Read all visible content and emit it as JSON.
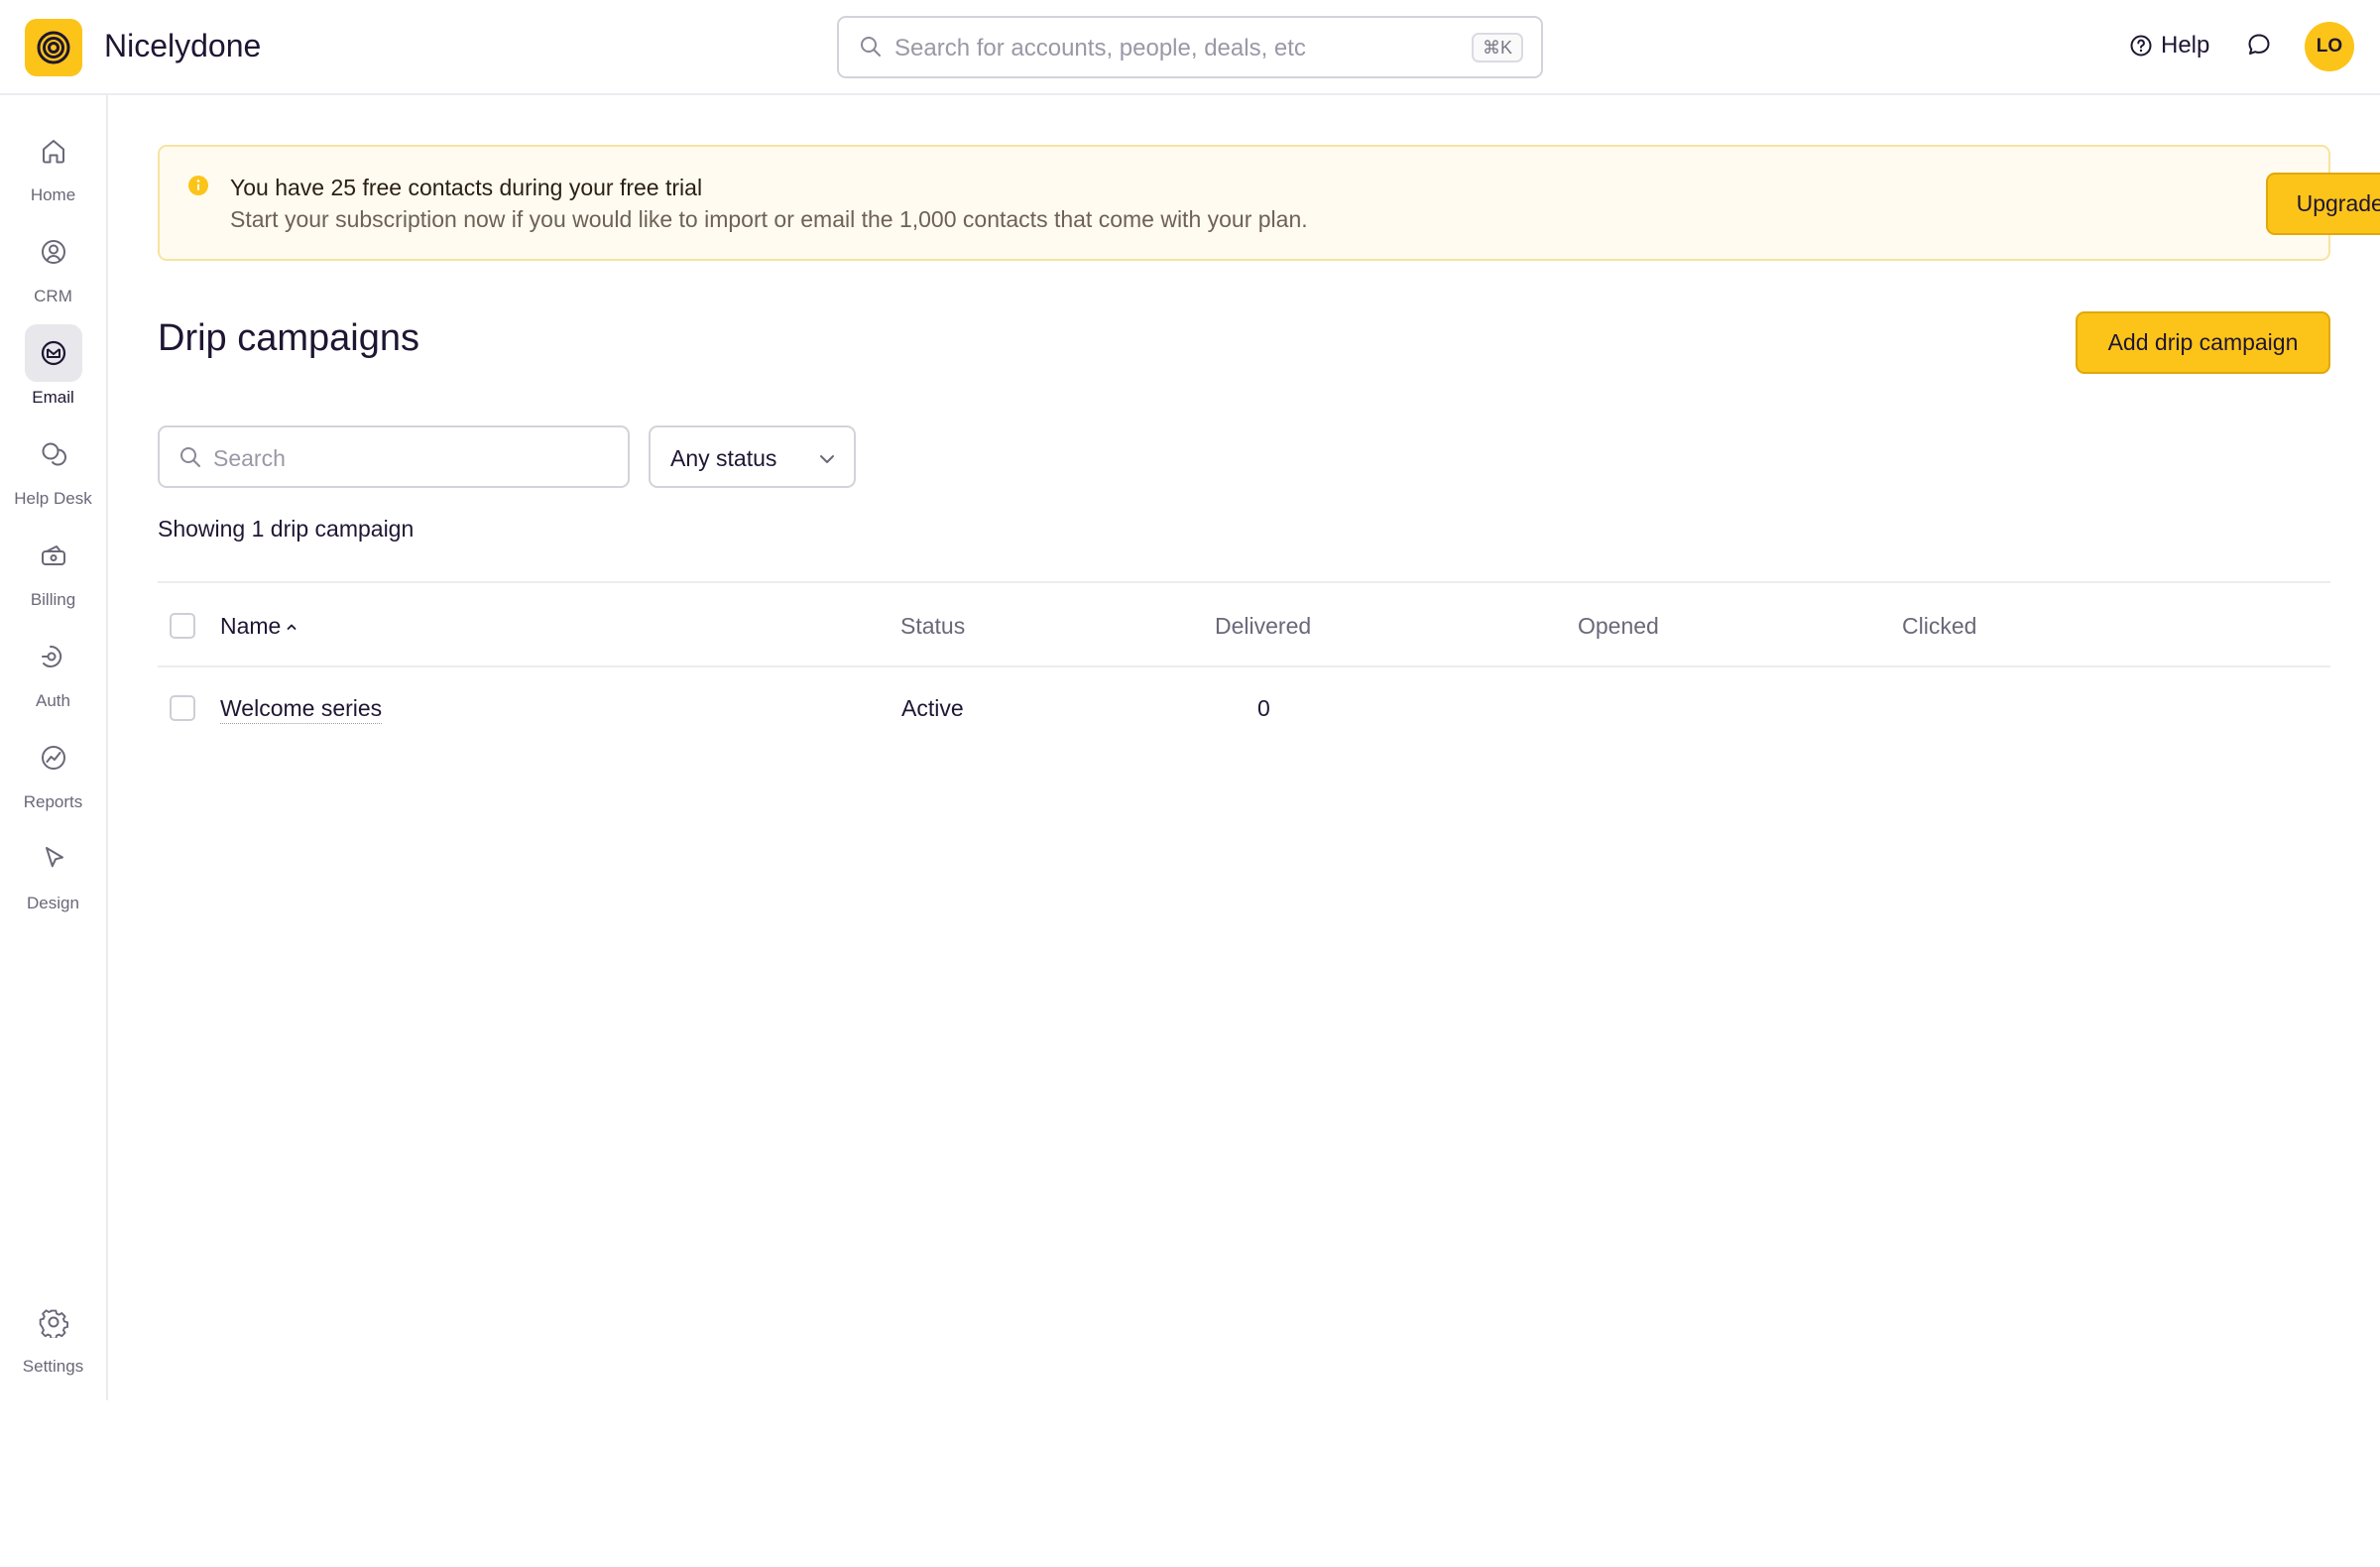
{
  "app": {
    "name": "Nicelydone"
  },
  "header": {
    "search_placeholder": "Search for accounts, people, deals, etc",
    "search_shortcut": "⌘K",
    "help_label": "Help",
    "avatar_initials": "LO"
  },
  "sidebar": {
    "items": [
      {
        "label": "Home",
        "icon": "home-icon",
        "active": false
      },
      {
        "label": "CRM",
        "icon": "crm-icon",
        "active": false
      },
      {
        "label": "Email",
        "icon": "email-icon",
        "active": true
      },
      {
        "label": "Help Desk",
        "icon": "helpdesk-icon",
        "active": false
      },
      {
        "label": "Billing",
        "icon": "billing-icon",
        "active": false
      },
      {
        "label": "Auth",
        "icon": "auth-icon",
        "active": false
      },
      {
        "label": "Reports",
        "icon": "reports-icon",
        "active": false
      },
      {
        "label": "Design",
        "icon": "design-icon",
        "active": false
      }
    ],
    "settings_label": "Settings"
  },
  "banner": {
    "title": "You have 25 free contacts during your free trial",
    "message": "Start your subscription now if you would like to import or email the 1,000 contacts that come with your plan.",
    "button_label": "Upgrade now"
  },
  "page": {
    "title": "Drip campaigns",
    "add_button_label": "Add drip campaign",
    "search_placeholder": "Search",
    "status_filter_value": "Any status",
    "showing_text": "Showing 1 drip campaign"
  },
  "table": {
    "columns": [
      "Name",
      "Status",
      "Delivered",
      "Opened",
      "Clicked"
    ],
    "rows": [
      {
        "name": "Welcome series",
        "status": "Active",
        "delivered": "0",
        "opened": "",
        "clicked": ""
      }
    ]
  },
  "colors": {
    "accent": "#fcc419",
    "banner_bg": "#fffbf0",
    "text": "#1f1633",
    "muted": "#6b6778"
  }
}
